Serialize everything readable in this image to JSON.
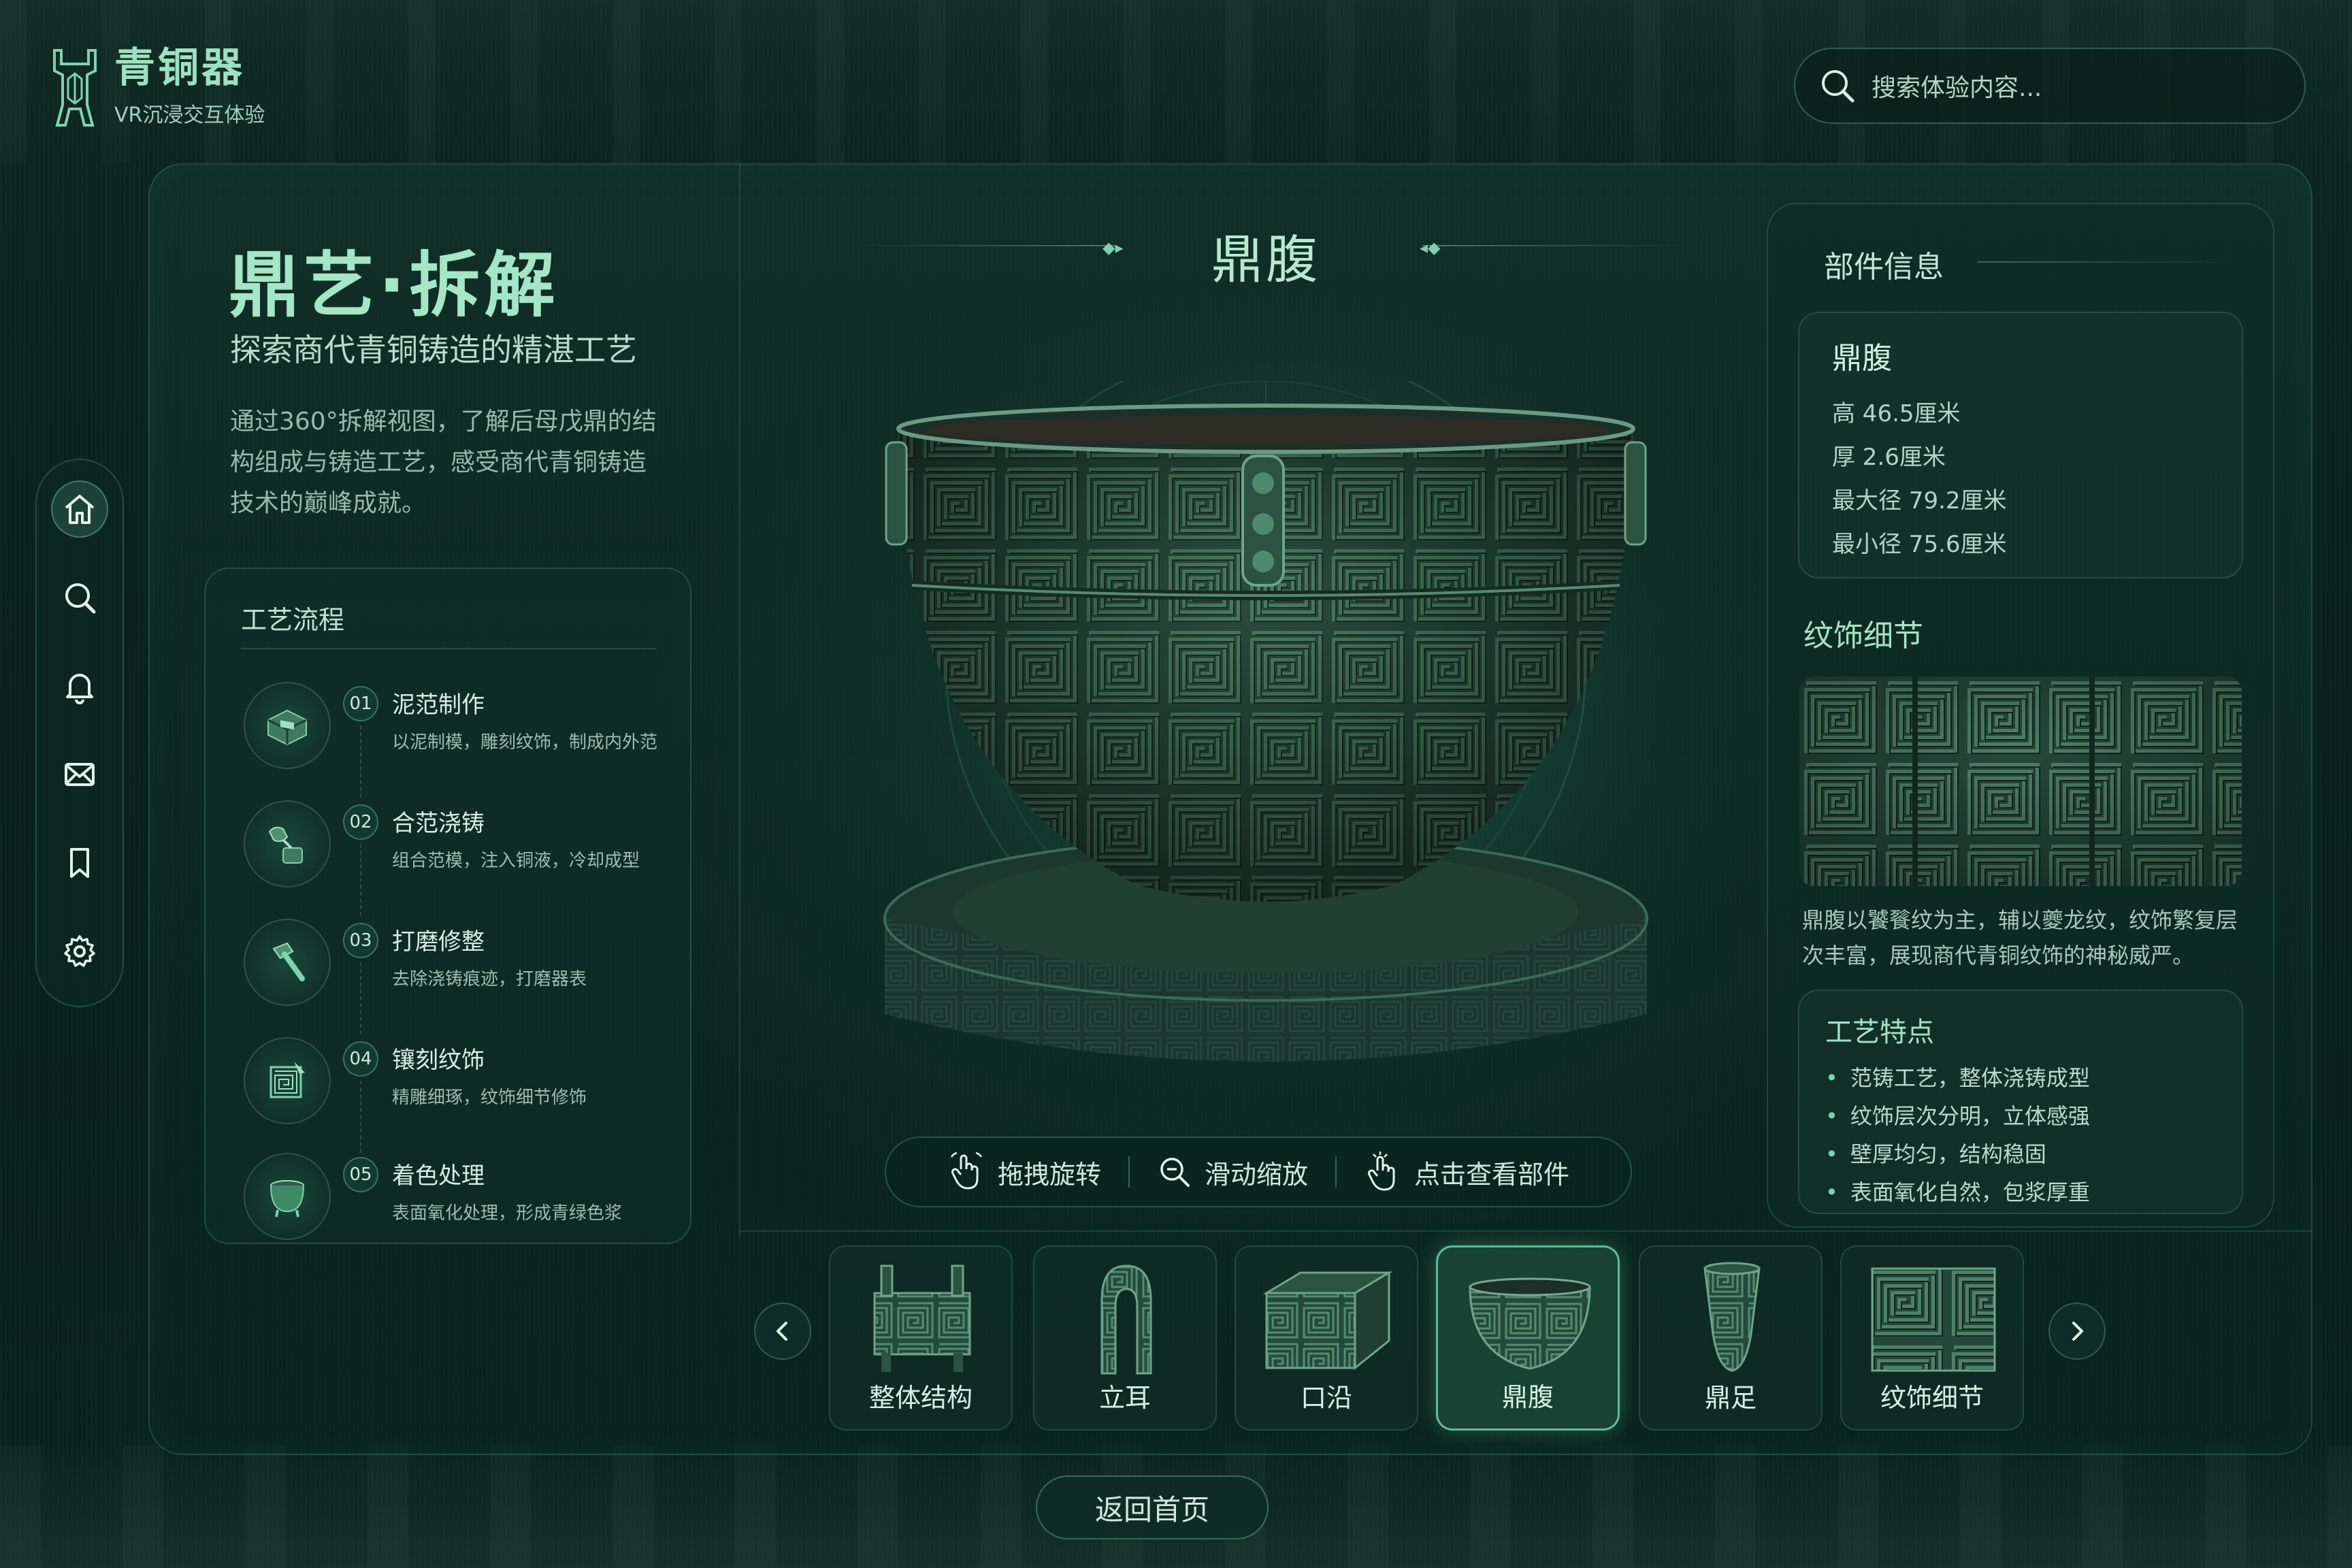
{
  "brand": {
    "title": "青铜器",
    "subtitle": "VR沉浸交互体验"
  },
  "search": {
    "placeholder": "搜索体验内容..."
  },
  "sidebar": {
    "items": [
      {
        "icon": "home-icon",
        "active": true
      },
      {
        "icon": "search-icon",
        "active": false
      },
      {
        "icon": "bell-icon",
        "active": false
      },
      {
        "icon": "mail-icon",
        "active": false
      },
      {
        "icon": "bookmark-icon",
        "active": false
      },
      {
        "icon": "gear-icon",
        "active": false
      }
    ]
  },
  "intro": {
    "title": "鼎艺·拆解",
    "subtitle": "探索商代青铜铸造的精湛工艺",
    "description": "通过360°拆解视图，了解后母戊鼎的结构组成与铸造工艺，感受商代青铜铸造技术的巅峰成就。"
  },
  "process": {
    "title": "工艺流程",
    "steps": [
      {
        "num": "01",
        "name": "泥范制作",
        "desc": "以泥制模，雕刻纹饰，制成内外范",
        "icon": "mold-icon"
      },
      {
        "num": "02",
        "name": "合范浇铸",
        "desc": "组合范模，注入铜液，冷却成型",
        "icon": "ladle-icon"
      },
      {
        "num": "03",
        "name": "打磨修整",
        "desc": "去除浇铸痕迹，打磨器表",
        "icon": "hammer-icon"
      },
      {
        "num": "04",
        "name": "镶刻纹饰",
        "desc": "精雕细琢，纹饰细节修饰",
        "icon": "carving-icon"
      },
      {
        "num": "05",
        "name": "着色处理",
        "desc": "表面氧化处理，形成青绿色浆",
        "icon": "cauldron-icon"
      }
    ]
  },
  "viewer": {
    "title": "鼎腹",
    "controls": [
      {
        "label": "拖拽旋转",
        "icon": "drag-hand-icon"
      },
      {
        "label": "滑动缩放",
        "icon": "zoom-out-icon"
      },
      {
        "label": "点击查看部件",
        "icon": "tap-hand-icon"
      }
    ]
  },
  "parts": {
    "items": [
      {
        "label": "整体结构",
        "active": false
      },
      {
        "label": "立耳",
        "active": false
      },
      {
        "label": "口沿",
        "active": false
      },
      {
        "label": "鼎腹",
        "active": true
      },
      {
        "label": "鼎足",
        "active": false
      },
      {
        "label": "纹饰细节",
        "active": false
      }
    ]
  },
  "info": {
    "heading": "部件信息",
    "part_name": "鼎腹",
    "specs": [
      "高 46.5厘米",
      "厚 2.6厘米",
      "最大径 79.2厘米",
      "最小径 75.6厘米"
    ],
    "pattern_title": "纹饰细节",
    "pattern_desc": "鼎腹以饕餮纹为主，辅以夔龙纹，纹饰繁复层次丰富，展现商代青铜纹饰的神秘威严。",
    "features_title": "工艺特点",
    "features": [
      "范铸工艺，整体浇铸成型",
      "纹饰层次分明，立体感强",
      "壁厚均匀，结构稳固",
      "表面氧化自然，包浆厚重"
    ]
  },
  "footer": {
    "home_label": "返回首页"
  },
  "colors": {
    "accent": "#7fd2ad",
    "title": "#a4e6c6",
    "bronze": "#2f5a48",
    "background": "#0a221c"
  }
}
